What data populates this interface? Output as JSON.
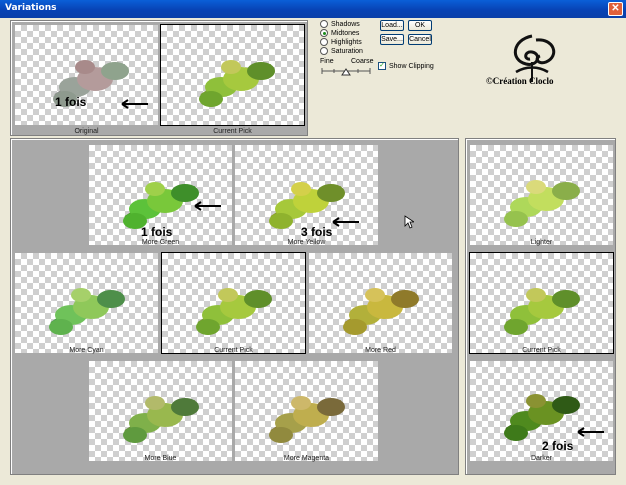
{
  "window": {
    "title": "Variations",
    "close_glyph": "✕"
  },
  "options": {
    "radios": [
      {
        "label": "Shadows",
        "selected": false
      },
      {
        "label": "Midtones",
        "selected": true
      },
      {
        "label": "Highlights",
        "selected": false
      },
      {
        "label": "Saturation",
        "selected": false
      }
    ],
    "buttons": {
      "load": "Load...",
      "ok": "OK",
      "save": "Save...",
      "cancel": "Cancel"
    },
    "slider": {
      "fine": "Fine",
      "coarse": "Coarse"
    },
    "show_clipping": {
      "label": "Show Clipping",
      "checked": true
    }
  },
  "logo": {
    "text": "©Création Cloclo"
  },
  "top": {
    "original": "Original",
    "current_pick": "Current Pick"
  },
  "grid": {
    "more_green": "More Green",
    "more_yellow": "More Yellow",
    "more_cyan": "More Cyan",
    "current_pick": "Current Pick",
    "more_red": "More Red",
    "more_blue": "More Blue",
    "more_magenta": "More Magenta"
  },
  "brightness": {
    "lighter": "Lighter",
    "current_pick": "Current Pick",
    "darker": "Darker"
  },
  "annotations": {
    "a1": "1 fois",
    "a2": "1 fois",
    "a3": "3 fois",
    "a4": "2 fois"
  },
  "colors": {
    "titlebar": "#0843b5",
    "panel": "#a9a9a9",
    "leaf_green": "#6fb22b"
  }
}
